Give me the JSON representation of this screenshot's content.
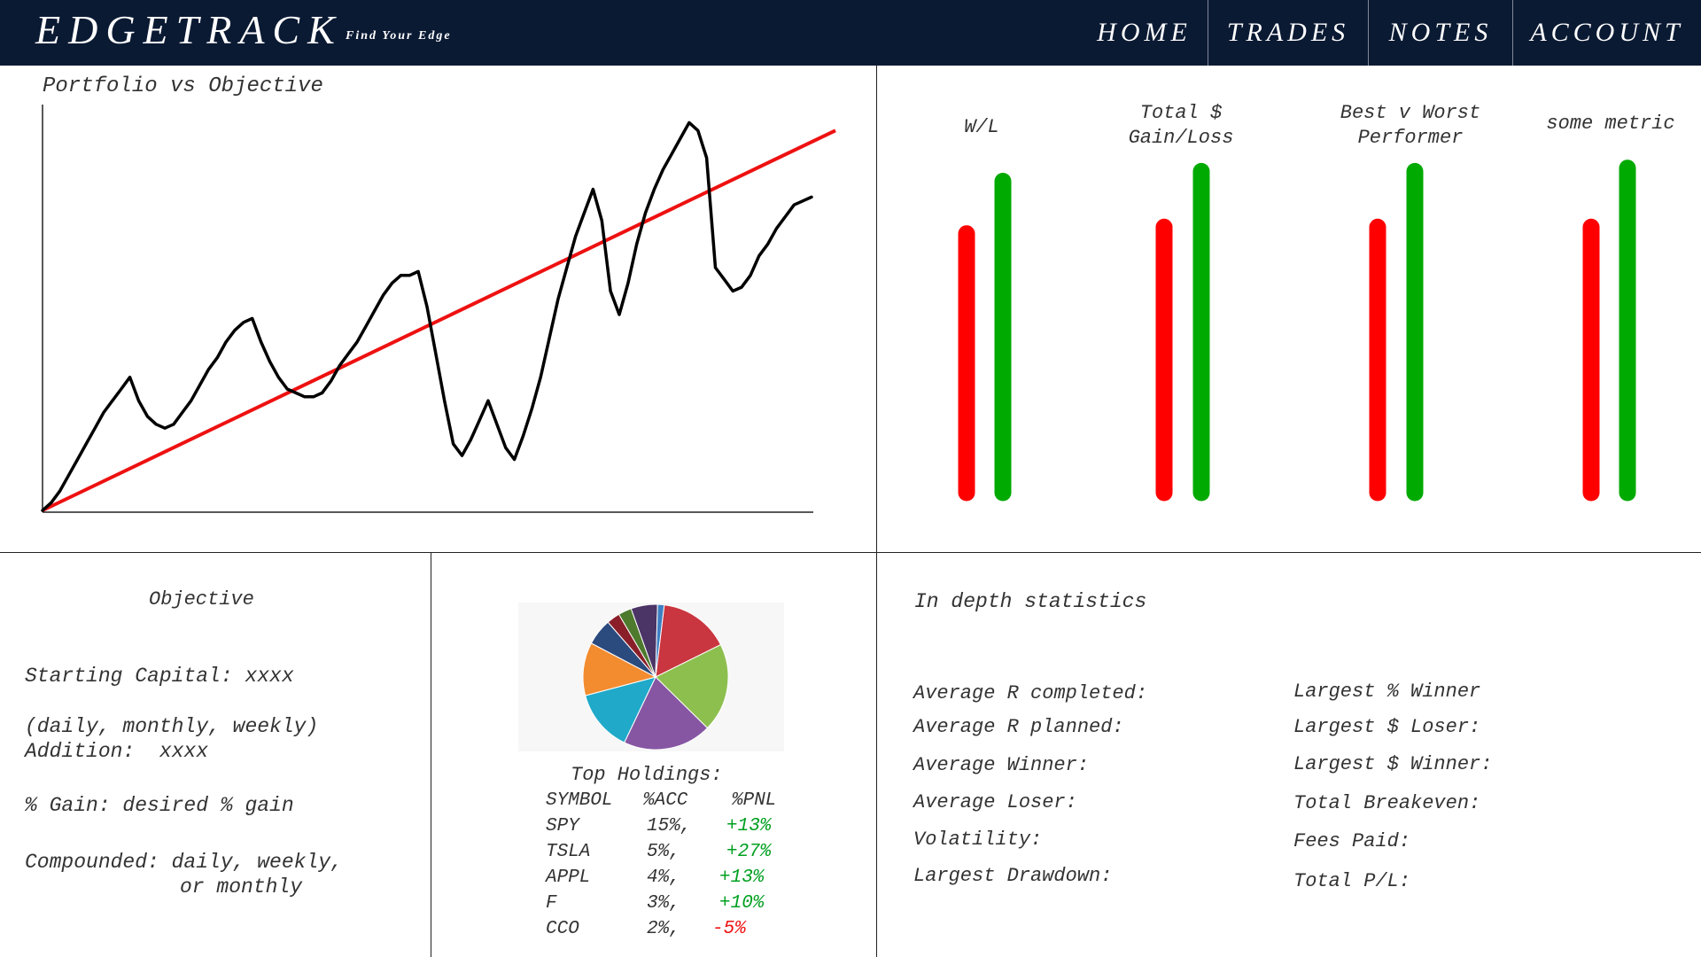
{
  "app": {
    "brand": "EDGETRACK",
    "tagline": "Find Your Edge"
  },
  "nav": {
    "items": [
      {
        "label": "HOME"
      },
      {
        "label": "TRADES"
      },
      {
        "label": "NOTES"
      },
      {
        "label": "ACCOUNT"
      }
    ]
  },
  "colors": {
    "header_bg": "#0b1a33",
    "loss_red": "#ff0000",
    "gain_green": "#00aa00",
    "objective_line": "#ee1111",
    "portfolio_line": "#000000"
  },
  "portfolio_chart": {
    "title": "Portfolio vs Objective",
    "chart_data": {
      "type": "line",
      "title": "Portfolio vs Objective",
      "xlabel": "",
      "ylabel": "",
      "x": [
        0,
        1,
        2,
        3,
        4,
        5,
        6,
        7,
        8,
        9,
        10,
        11,
        12,
        13,
        14,
        15,
        16,
        17,
        18,
        19,
        20,
        21,
        22,
        23,
        24,
        25,
        26,
        27,
        28,
        29,
        30,
        31,
        32,
        33,
        34,
        35,
        36,
        37,
        38,
        39,
        40,
        41,
        42,
        43,
        44,
        45,
        46,
        47,
        48,
        49,
        50,
        51,
        52,
        53,
        54,
        55,
        56,
        57,
        58,
        59,
        60,
        61,
        62,
        63,
        64,
        65,
        66,
        67,
        68,
        69,
        70,
        71,
        72,
        73,
        74,
        75,
        76,
        77,
        78,
        79,
        80,
        81,
        82,
        83,
        84,
        85,
        86,
        87,
        88,
        89,
        90,
        91,
        92,
        93,
        94,
        95,
        96,
        97,
        98,
        99,
        100
      ],
      "ylim": [
        0,
        100
      ],
      "xlim": [
        0,
        100
      ],
      "series": [
        {
          "values": [
            0,
            2,
            5,
            9,
            13,
            17,
            21,
            25,
            28,
            31,
            34,
            28,
            24,
            22,
            21,
            22,
            25,
            28,
            32,
            36,
            39,
            43,
            46,
            48,
            49,
            43,
            38,
            34,
            31,
            30,
            29,
            29,
            30,
            33,
            37,
            40,
            43,
            47,
            51,
            55,
            58,
            60,
            60,
            61,
            52,
            40,
            28,
            17,
            14,
            18,
            23,
            28,
            22,
            16,
            13,
            19,
            26,
            34,
            44,
            54,
            62,
            70,
            76,
            82,
            74,
            56,
            50,
            58,
            68,
            76,
            82,
            87,
            91,
            95,
            99,
            97,
            90,
            62,
            59,
            56,
            57,
            60,
            65,
            68,
            72,
            75,
            78,
            79,
            80,
            81,
            81,
            81,
            81,
            81,
            81,
            81,
            81,
            81,
            81,
            81,
            81
          ]
        },
        {
          "values": [
            0,
            0.97,
            1.94,
            2.91,
            3.88,
            4.85,
            5.82,
            6.79,
            7.76,
            8.73,
            9.7,
            10.67,
            11.64,
            12.61,
            13.58,
            14.55,
            15.52,
            16.49,
            17.46,
            18.43,
            19.4,
            20.37,
            21.34,
            22.31,
            23.28,
            24.25,
            25.22,
            26.19,
            27.16,
            28.13,
            29.1,
            30.07,
            31.04,
            32.01,
            32.98,
            33.95,
            34.92,
            35.89,
            36.86,
            37.83,
            38.8,
            39.77,
            40.74,
            41.71,
            42.68,
            43.65,
            44.62,
            45.59,
            46.56,
            47.53,
            48.5,
            49.47,
            50.44,
            51.41,
            52.38,
            53.35,
            54.32,
            55.29,
            56.26,
            57.23,
            58.2,
            59.17,
            60.14,
            61.11,
            62.08,
            63.05,
            64.02,
            64.99,
            65.96,
            66.93,
            67.9,
            68.87,
            69.84,
            70.81,
            71.78,
            72.75,
            73.72,
            74.69,
            75.66,
            76.63,
            77.6,
            78.57,
            79.54,
            80.51,
            81.48,
            82.45,
            83.42,
            84.39,
            85.36,
            86.33,
            87.3,
            88.27,
            89.24,
            90.21,
            91.18,
            92.15,
            93.12,
            94.09,
            95.06,
            96.03,
            97
          ]
        }
      ]
    }
  },
  "metrics": {
    "items": [
      {
        "label": "W/L",
        "loss": 0.79,
        "gain": 0.95
      },
      {
        "label": "Total $\nGain/Loss",
        "loss": 0.81,
        "gain": 0.98
      },
      {
        "label": "Best v Worst\nPerformer",
        "loss": 0.81,
        "gain": 0.98
      },
      {
        "label": "some metric",
        "loss": 0.81,
        "gain": 0.99
      }
    ]
  },
  "objective": {
    "title": "Objective",
    "starting_capital": "Starting Capital: xxxx",
    "frequency": "(daily, monthly, weekly)",
    "addition": "Addition:  xxxx",
    "gain": "% Gain: desired % gain",
    "compounded": "Compounded: daily, weekly,",
    "compounded_2": "or monthly"
  },
  "holdings": {
    "title": "Top Holdings:",
    "columns": [
      "SYMBOL",
      "%ACC",
      "%PNL"
    ],
    "rows": [
      {
        "symbol": "SPY",
        "acc": "15%,",
        "pnl": "+13%",
        "positive": true
      },
      {
        "symbol": "TSLA",
        "acc": "5%,",
        "pnl": "+27%",
        "positive": true
      },
      {
        "symbol": "APPL",
        "acc": "4%,",
        "pnl": "+13%",
        "positive": true
      },
      {
        "symbol": "F",
        "acc": "3%,",
        "pnl": "+10%",
        "positive": true
      },
      {
        "symbol": "CCO",
        "acc": "2%,",
        "pnl": "-5%",
        "positive": false
      }
    ],
    "pie": {
      "slices": [
        {
          "value": 16,
          "color": "#c9363f"
        },
        {
          "value": 20,
          "color": "#8dbf4f"
        },
        {
          "value": 20,
          "color": "#8656a3"
        },
        {
          "value": 14,
          "color": "#20a9c9"
        },
        {
          "value": 12,
          "color": "#f28c2f"
        },
        {
          "value": 6,
          "color": "#2b4a7e"
        },
        {
          "value": 3,
          "color": "#8a1f2a"
        },
        {
          "value": 3,
          "color": "#4e7a2e"
        },
        {
          "value": 6,
          "color": "#4b3466"
        },
        {
          "value": 1.5,
          "color": "#3d7fc2"
        }
      ]
    }
  },
  "stats": {
    "title": "In depth statistics",
    "left": [
      "Average R completed:",
      "Average R planned:",
      "Average Winner:",
      "Average Loser:",
      "Volatility:",
      "Largest Drawdown:"
    ],
    "right": [
      "Largest % Winner",
      "Largest $ Loser:",
      "Largest $ Winner:",
      "Total Breakeven:",
      "Fees Paid:",
      "Total P/L:"
    ]
  }
}
